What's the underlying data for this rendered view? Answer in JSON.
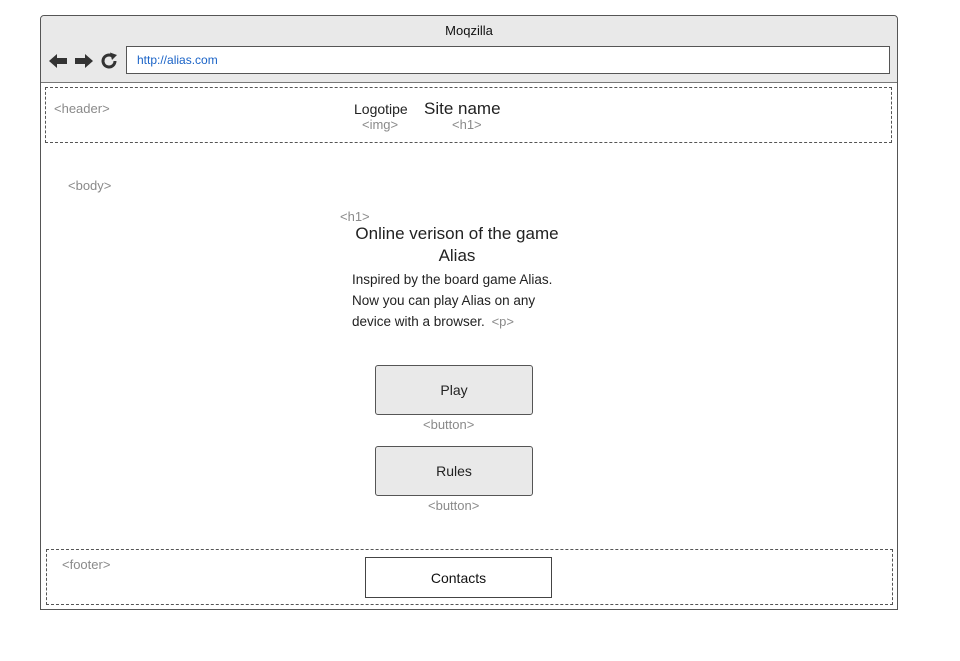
{
  "window": {
    "title": "Moqzilla",
    "url": "http://alias.com"
  },
  "icons": {
    "back": "arrow-left-icon",
    "forward": "arrow-right-icon",
    "reload": "reload-icon"
  },
  "header": {
    "tag": "<header>",
    "logo_text": "Logotipe",
    "logo_tag": "<img>",
    "site_name": "Site name",
    "site_name_tag": "<h1>"
  },
  "body": {
    "tag": "<body>",
    "heading_tag": "<h1>",
    "heading_line1": "Online verison of the game",
    "heading_line2": "Alias",
    "paragraph_line1": "Inspired by the board game Alias.",
    "paragraph_line2": "Now you can play Alias on any",
    "paragraph_line3": "device with a browser.",
    "paragraph_tag": "<p>",
    "play_label": "Play",
    "play_tag": "<button>",
    "rules_label": "Rules",
    "rules_tag": "<button>"
  },
  "footer": {
    "tag": "<footer>",
    "contacts_label": "Contacts"
  }
}
